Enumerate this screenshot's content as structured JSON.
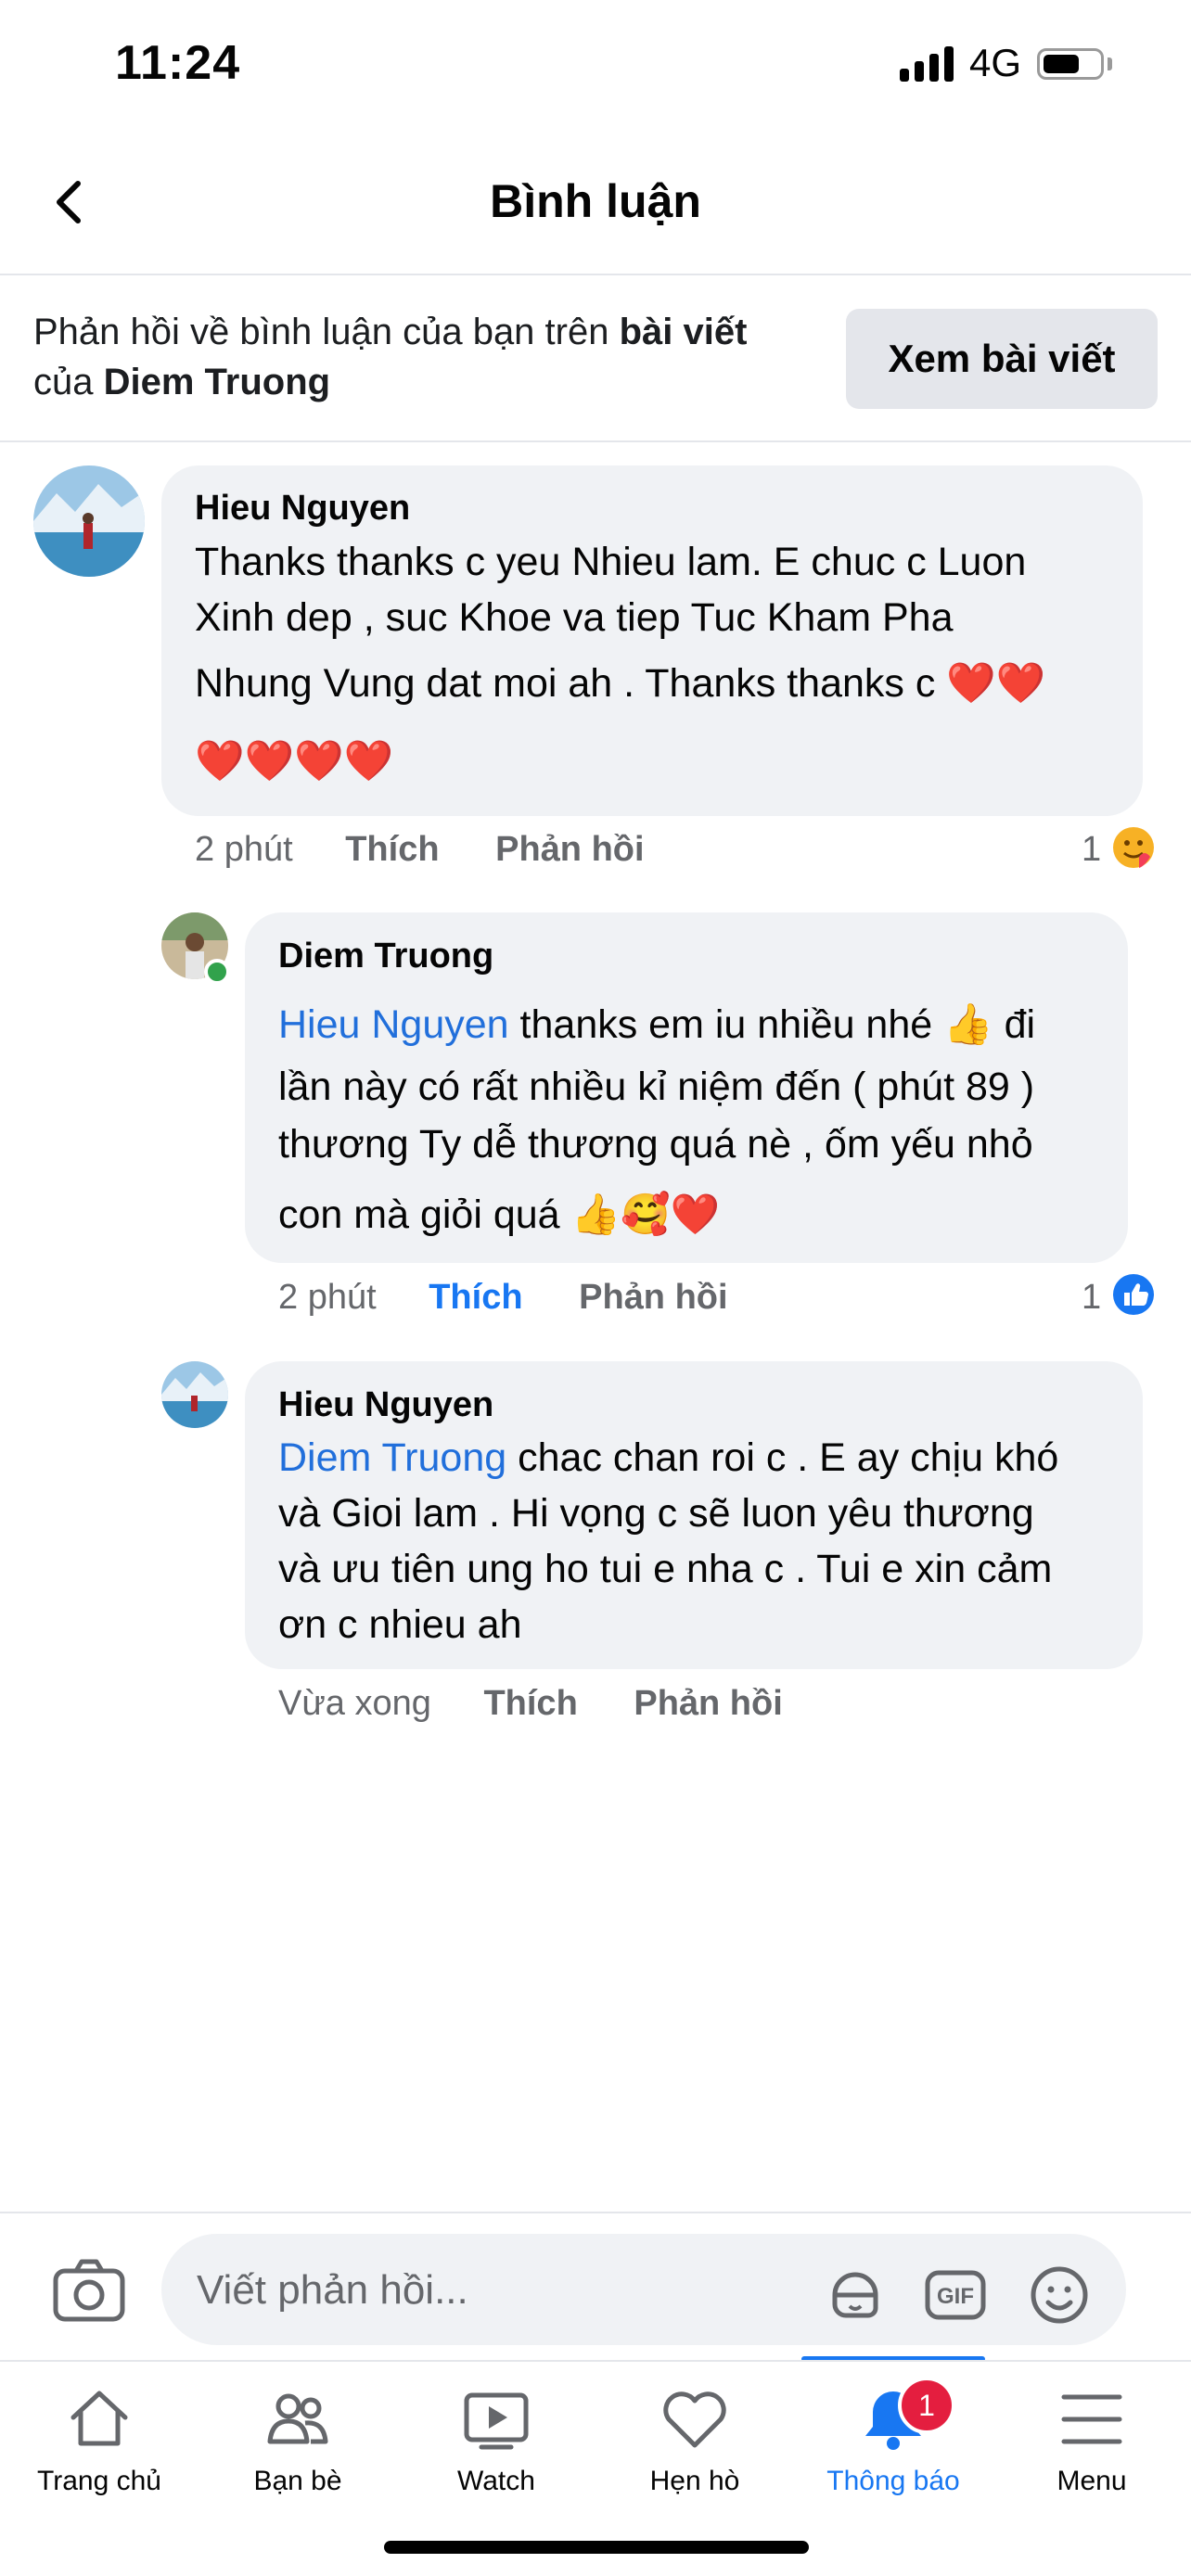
{
  "status_bar": {
    "time": "11:24",
    "network": "4G",
    "battery_level": 0.65
  },
  "header": {
    "title": "Bình luận"
  },
  "banner": {
    "text_before": "Phản hồi về bình luận của bạn trên ",
    "link_post": "bài viết",
    "text_middle": " của ",
    "post_author": "Diem Truong",
    "view_post_label": "Xem bài viết"
  },
  "comments": [
    {
      "author": "Hieu Nguyen",
      "lines": [
        "Thanks thanks c yeu Nhieu lam. E chuc c Luon",
        "Xinh dep , suc Khoe va tiep Tuc Kham Pha",
        "Nhung Vung dat moi ah . Thanks thanks c"
      ],
      "emoji_line_end": "❤️❤️",
      "emoji_line": "❤️❤️❤️❤️",
      "time": "2 phút",
      "like_label": "Thích",
      "reply_label": "Phản hồi",
      "reaction_count": "1",
      "reaction_icon": "care-reaction-icon"
    },
    {
      "author": "Diem Truong",
      "mention": "Hieu Nguyen",
      "line1_rest": " thanks em iu nhiều nhé 👍 đi",
      "lines": [
        "lần này có rất nhiều kỉ niệm đến ( phút 89 )",
        "thương Ty dễ thương quá nè , ốm yếu nhỏ",
        "con mà giỏi quá 👍🥰❤️"
      ],
      "time": "2 phút",
      "like_label": "Thích",
      "reply_label": "Phản hồi",
      "reaction_count": "1",
      "reaction_icon": "like-reaction-icon"
    },
    {
      "author": "Hieu Nguyen",
      "mention": "Diem Truong",
      "line1_rest": " chac chan roi c . E ay chịu khó",
      "lines": [
        "và Gioi lam . Hi vọng c sẽ luon yêu thương",
        "và ưu tiên ung ho tui e nha c . Tui e xin cảm",
        "ơn c nhieu ah"
      ],
      "time": "Vừa xong",
      "like_label": "Thích",
      "reply_label": "Phản hồi"
    }
  ],
  "composer": {
    "placeholder": "Viết phản hồi..."
  },
  "tabs": [
    {
      "label": "Trang chủ",
      "icon": "home-icon"
    },
    {
      "label": "Bạn bè",
      "icon": "friends-icon"
    },
    {
      "label": "Watch",
      "icon": "watch-icon"
    },
    {
      "label": "Hẹn hò",
      "icon": "dating-heart-icon"
    },
    {
      "label": "Thông báo",
      "icon": "bell-icon",
      "badge": "1",
      "active": true
    },
    {
      "label": "Menu",
      "icon": "menu-icon"
    }
  ],
  "colors": {
    "accent": "#1877f2",
    "mention": "#216fdb",
    "bubble": "#f0f2f5",
    "badge": "#e41e3f"
  }
}
